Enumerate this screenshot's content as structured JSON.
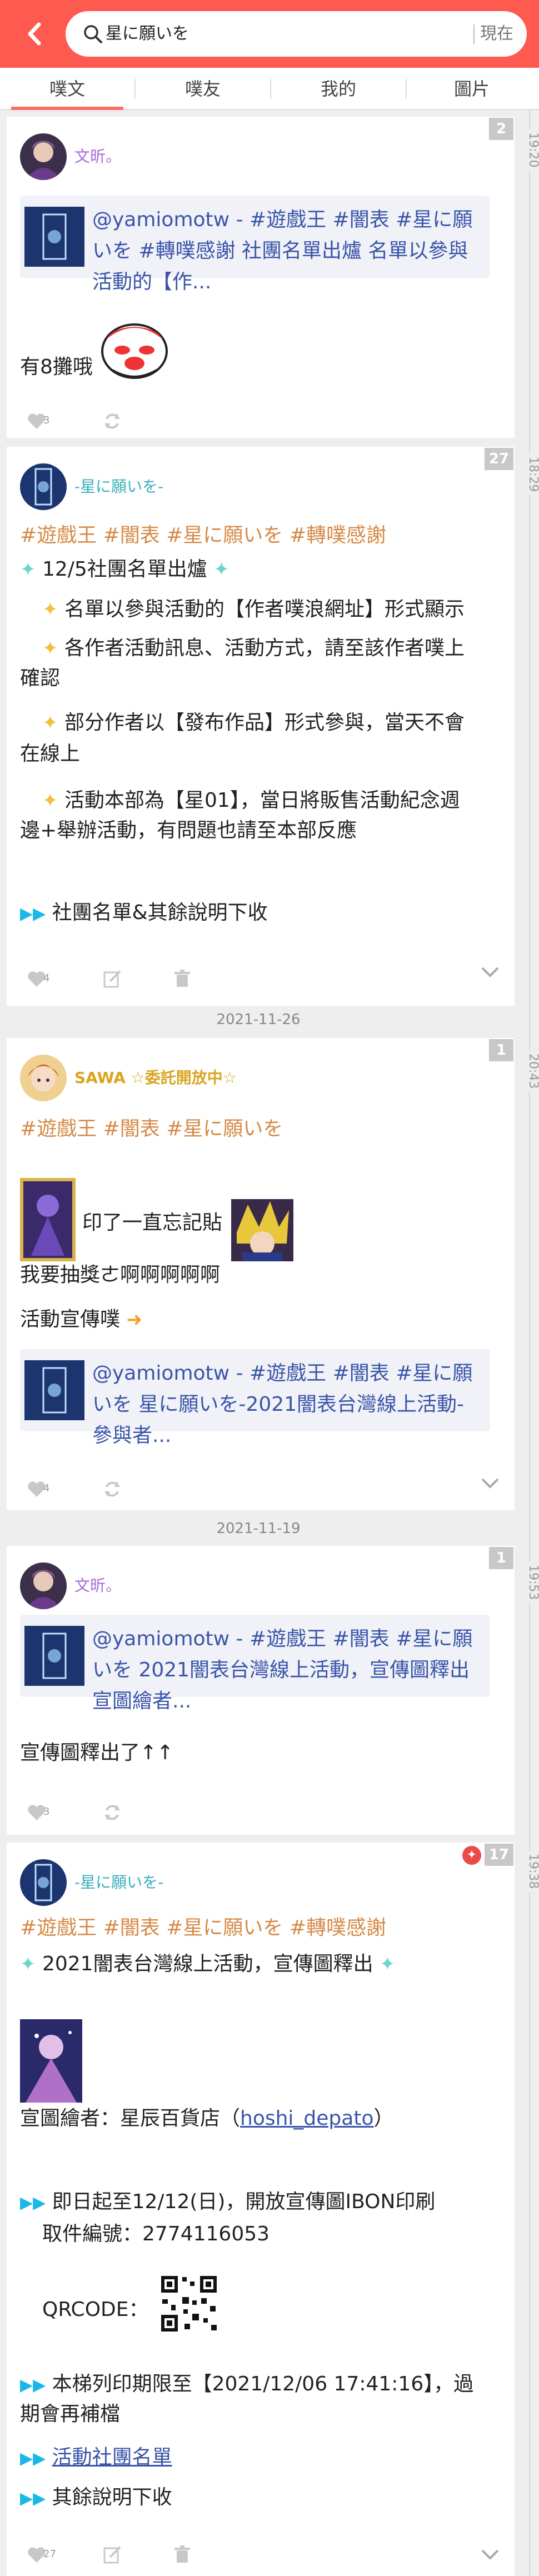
{
  "header": {
    "back_icon": "chevron-left-icon",
    "search_query": "星に願いを",
    "search_scope": "現在"
  },
  "tabs": [
    {
      "label": "噗文",
      "active": true
    },
    {
      "label": "噗友",
      "active": false
    },
    {
      "label": "我的",
      "active": false
    },
    {
      "label": "圖片",
      "active": false
    }
  ],
  "times": [
    "19:20",
    "18:29",
    "20:43",
    "19:53",
    "19:38"
  ],
  "dates": [
    "2021-11-26",
    "2021-11-19"
  ],
  "posts": [
    {
      "badge": "2",
      "author": "文昕。",
      "link_text": "@yamiomotw - #遊戲王 #闇表 #星に願いを #轉噗感謝 社團名單出爐 名單以參與活動的【作...",
      "text": "有8攤哦",
      "likes": "3"
    },
    {
      "badge": "27",
      "author": "-星に願いを-",
      "tags": "#遊戲王 #闇表 #星に願いを #轉噗感謝",
      "line1": "12/5社團名單出爐",
      "line2": "名單以參與活動的【作者噗浪網址】形式顯示",
      "line3a": "各作者活動訊息、活動方式，請至該作者噗上",
      "line3b": "確認",
      "line4a": "部分作者以【發布作品】形式參與，當天不會",
      "line4b": "在線上",
      "line5a": "活動本部為【星01】，當日將販售活動紀念週",
      "line5b": "邊+舉辦活動，有問題也請至本部反應",
      "line6": "社團名單&其餘說明下收",
      "likes": "4"
    },
    {
      "badge": "1",
      "author": "SAWA ☆委託開放中☆",
      "tags": "#遊戲王 #闇表 #星に願いを",
      "line1": "印了一直忘記貼",
      "line2": "我要抽獎ㄜ啊啊啊啊啊",
      "line3": "活動宣傳噗",
      "link_text": "@yamiomotw - #遊戲王 #闇表 #星に願いを 星に願いを-2021闇表台灣線上活動- 參與者...",
      "likes": "4"
    },
    {
      "badge": "1",
      "author": "文昕。",
      "link_text": "@yamiomotw - #遊戲王 #闇表 #星に願いを 2021闇表台灣線上活動，宣傳圖釋出 宣圖繪者...",
      "text": "宣傳圖釋出了↑↑",
      "likes": "3"
    },
    {
      "badge": "17",
      "author": "-星に願いを-",
      "tags": "#遊戲王 #闇表 #星に願いを #轉噗感謝",
      "line1": "2021闇表台灣線上活動，宣傳圖釋出",
      "line2_prefix": "宣圖繪者：星辰百貨店（",
      "line2_link": "hoshi_depato",
      "line2_suffix": "）",
      "line3": "即日起至12/12(日)，開放宣傳圖IBON印刷",
      "line4": "取件編號：2774116053",
      "line5": "QRCODE：",
      "line6a": "本梯列印期限至【2021/12/06 17:41:16】，過",
      "line6b": "期會再補檔",
      "line7": "活動社團名單",
      "line8": "其餘說明下收",
      "likes": "27"
    }
  ],
  "colors": {
    "header": "#ff5a4f",
    "tag": "#d58a46",
    "link": "#3a54a8"
  }
}
